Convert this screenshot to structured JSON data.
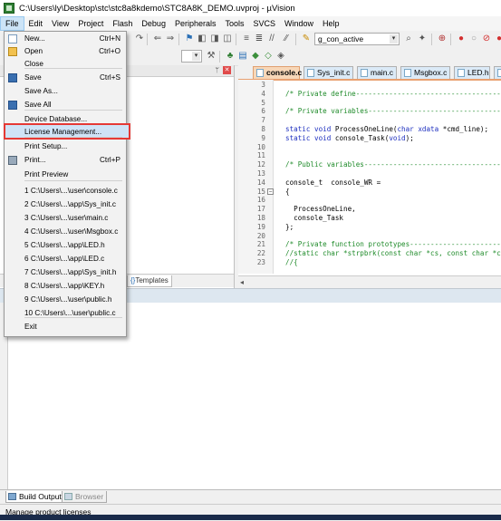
{
  "window": {
    "title": "C:\\Users\\ly\\Desktop\\stc\\stc8a8kdemo\\STC8A8K_DEMO.uvproj - µVision"
  },
  "menubar": [
    "File",
    "Edit",
    "View",
    "Project",
    "Flash",
    "Debug",
    "Peripherals",
    "Tools",
    "SVCS",
    "Window",
    "Help"
  ],
  "toolbar": {
    "target_combo": "g_con_active"
  },
  "file_menu": {
    "items": [
      {
        "label": "New...",
        "shortcut": "Ctrl+N",
        "icon": "new-file-icon"
      },
      {
        "label": "Open",
        "shortcut": "Ctrl+O",
        "icon": "open-folder-icon"
      },
      {
        "label": "Close",
        "shortcut": ""
      },
      {
        "label": "Save",
        "shortcut": "Ctrl+S",
        "icon": "save-icon"
      },
      {
        "label": "Save As...",
        "shortcut": ""
      },
      {
        "label": "Save All",
        "shortcut": "",
        "icon": "save-all-icon"
      },
      {
        "label": "Device Database...",
        "shortcut": ""
      },
      {
        "label": "License Management...",
        "shortcut": ""
      },
      {
        "label": "Print Setup...",
        "shortcut": ""
      },
      {
        "label": "Print...",
        "shortcut": "Ctrl+P",
        "icon": "print-icon"
      },
      {
        "label": "Print Preview",
        "shortcut": ""
      },
      {
        "label": "1 C:\\Users\\...\\user\\console.c",
        "shortcut": ""
      },
      {
        "label": "2 C:\\Users\\...\\app\\Sys_init.c",
        "shortcut": ""
      },
      {
        "label": "3 C:\\Users\\...\\user\\main.c",
        "shortcut": ""
      },
      {
        "label": "4 C:\\Users\\...\\user\\Msgbox.c",
        "shortcut": ""
      },
      {
        "label": "5 C:\\Users\\...\\app\\LED.h",
        "shortcut": ""
      },
      {
        "label": "6 C:\\Users\\...\\app\\LED.c",
        "shortcut": ""
      },
      {
        "label": "7 C:\\Users\\...\\app\\Sys_init.h",
        "shortcut": ""
      },
      {
        "label": "8 C:\\Users\\...\\app\\KEY.h",
        "shortcut": ""
      },
      {
        "label": "9 C:\\Users\\...\\user\\public.h",
        "shortcut": ""
      },
      {
        "label": "10 C:\\Users\\...\\user\\public.c",
        "shortcut": ""
      },
      {
        "label": "Exit",
        "shortcut": ""
      }
    ],
    "highlighted": "License Management..."
  },
  "editor_tabs": [
    "console.c",
    "Sys_init.c",
    "main.c",
    "Msgbox.c",
    "LED.h",
    "LED.c"
  ],
  "active_tab": "console.c",
  "code_lines": [
    {
      "n": "3",
      "t": ""
    },
    {
      "n": "4",
      "t": "/* Private define----------------------------------------"
    },
    {
      "n": "5",
      "t": ""
    },
    {
      "n": "6",
      "t": "/* Private variables-------------------------------------"
    },
    {
      "n": "7",
      "t": ""
    },
    {
      "n": "8",
      "t": "static void ProcessOneLine(char xdata *cmd_line);"
    },
    {
      "n": "9",
      "t": "static void console_Task(void);"
    },
    {
      "n": "10",
      "t": ""
    },
    {
      "n": "11",
      "t": ""
    },
    {
      "n": "12",
      "t": "/* Public variables--------------------------------------"
    },
    {
      "n": "13",
      "t": ""
    },
    {
      "n": "14",
      "t": "console_t  console_WR ="
    },
    {
      "n": "15",
      "t": "{"
    },
    {
      "n": "16",
      "t": ""
    },
    {
      "n": "17",
      "t": "  ProcessOneLine,"
    },
    {
      "n": "18",
      "t": "  console_Task"
    },
    {
      "n": "19",
      "t": "};"
    },
    {
      "n": "20",
      "t": ""
    },
    {
      "n": "21",
      "t": "/* Private function prototypes---------------------------"
    },
    {
      "n": "22",
      "t": "//static char *strpbrk(const char *cs, const char *ct);"
    },
    {
      "n": "23",
      "t": "//{"
    }
  ],
  "left_panel": {
    "templates_tab": "Templates"
  },
  "output_tabs": [
    "Build Output",
    "Browser"
  ],
  "status": {
    "text": "Manage product licenses"
  }
}
